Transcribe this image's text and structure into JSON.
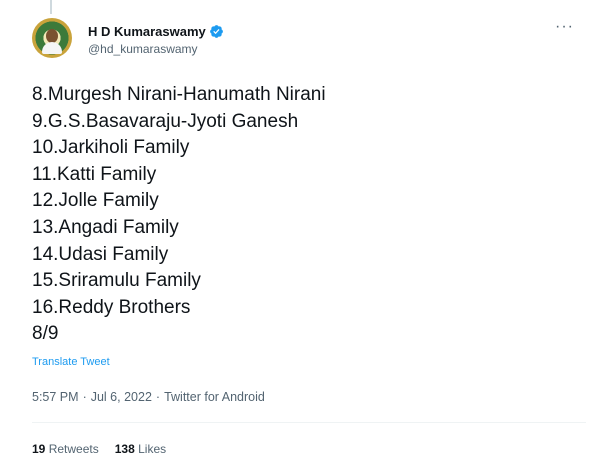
{
  "author": {
    "display_name": "H D Kumaraswamy",
    "handle": "@hd_kumaraswamy",
    "verified": true
  },
  "more_icon": "more-horizontal-icon",
  "tweet_lines": [
    "8.Murgesh Nirani-Hanumath Nirani",
    "9.G.S.Basavaraju-Jyoti Ganesh",
    "10.Jarkiholi Family",
    "11.Katti Family",
    "12.Jolle Family",
    "13.Angadi Family",
    "14.Udasi Family",
    "15.Sriramulu Family",
    "16.Reddy Brothers",
    "8/9"
  ],
  "translate_label": "Translate Tweet",
  "meta": {
    "time": "5:57 PM",
    "date": "Jul 6, 2022",
    "source": "Twitter for Android"
  },
  "stats": {
    "retweets_count": "19",
    "retweets_label": "Retweets",
    "likes_count": "138",
    "likes_label": "Likes"
  },
  "colors": {
    "link": "#1d9bf0",
    "secondary_text": "#536471",
    "verified_badge": "#1d9bf0"
  }
}
